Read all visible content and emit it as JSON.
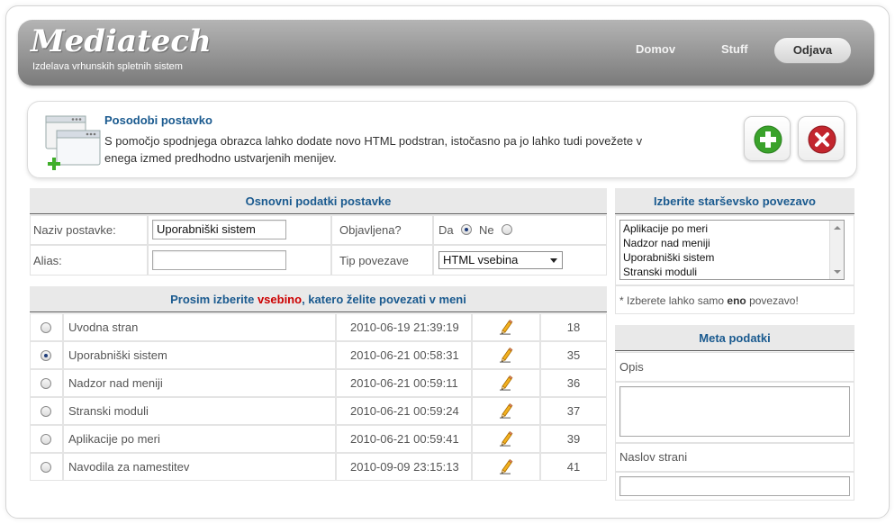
{
  "header": {
    "logo": "Mediatech",
    "tagline": "Izdelava vrhunskih spletnih sistem",
    "nav": {
      "home": "Domov",
      "stuff": "Stuff",
      "logout": "Odjava"
    }
  },
  "info": {
    "title": "Posodobi postavko",
    "text": "S pomočjo spodnjega obrazca lahko dodate novo HTML podstran, istočasno pa jo lahko tudi povežete v enega izmed predhodno ustvarjenih menijev."
  },
  "basic": {
    "heading": "Osnovni podatki postavke",
    "name_label": "Naziv postavke:",
    "name_value": "Uporabniški sistem",
    "alias_label": "Alias:",
    "alias_value": "",
    "published_label": "Objavljena?",
    "published_yes": "Da",
    "published_no": "Ne",
    "published_selected": "Da",
    "link_type_label": "Tip povezave",
    "link_type_value": "HTML vsebina"
  },
  "content": {
    "heading_pre": "Prosim izberite ",
    "heading_em": "vsebino",
    "heading_post": ", katero želite povezati v meni",
    "accent_color": "#cc0000",
    "rows": [
      {
        "name": "Uvodna stran",
        "date": "2010-06-19 21:39:19",
        "id": "18",
        "selected": false
      },
      {
        "name": "Uporabniški sistem",
        "date": "2010-06-21 00:58:31",
        "id": "35",
        "selected": true
      },
      {
        "name": "Nadzor nad meniji",
        "date": "2010-06-21 00:59:11",
        "id": "36",
        "selected": false
      },
      {
        "name": "Stranski moduli",
        "date": "2010-06-21 00:59:24",
        "id": "37",
        "selected": false
      },
      {
        "name": "Aplikacije po meri",
        "date": "2010-06-21 00:59:41",
        "id": "39",
        "selected": false
      },
      {
        "name": "Navodila za namestitev",
        "date": "2010-09-09 23:15:13",
        "id": "41",
        "selected": false
      }
    ]
  },
  "parent": {
    "heading": "Izberite starševsko povezavo",
    "options": [
      "Aplikacije po meri",
      "Nadzor nad meniji",
      "Uporabniški sistem",
      "Stranski moduli"
    ],
    "note_pre": "* Izberete lahko samo ",
    "note_em": "eno",
    "note_post": " povezavo!"
  },
  "meta": {
    "heading": "Meta podatki",
    "description_label": "Opis",
    "page_title_label": "Naslov strani"
  },
  "icons": {
    "add": "plus-icon",
    "delete": "x-icon",
    "edit": "pencil-icon",
    "page": "window-add-icon"
  }
}
